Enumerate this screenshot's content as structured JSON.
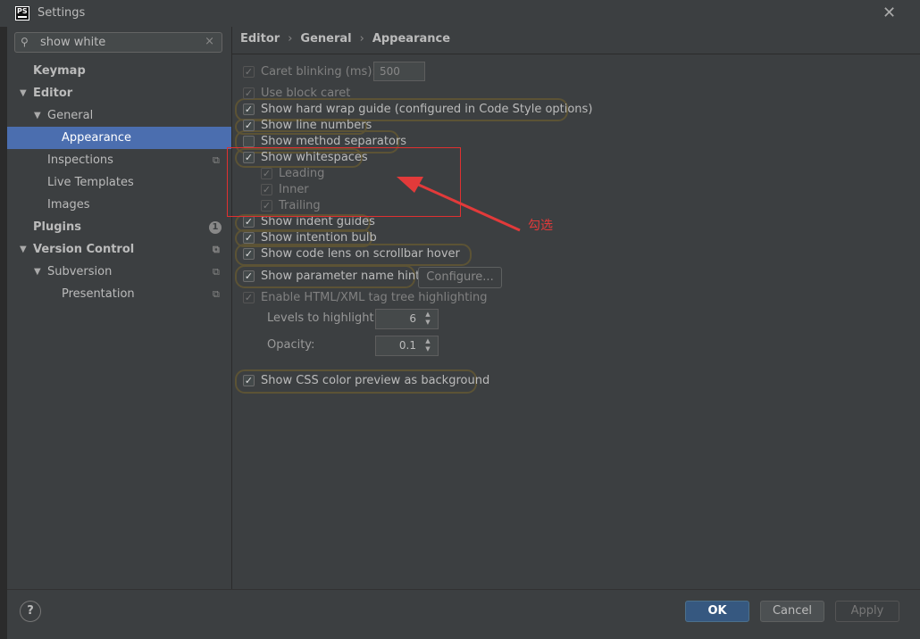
{
  "window": {
    "title": "Settings",
    "app_icon_text": "PS"
  },
  "search": {
    "value": "show white",
    "placeholder": ""
  },
  "tree": [
    {
      "label": "Keymap",
      "level": 0,
      "bold": true
    },
    {
      "label": "Editor",
      "level": 0,
      "bold": true,
      "expanded": true
    },
    {
      "label": "General",
      "level": 1,
      "expanded": true
    },
    {
      "label": "Appearance",
      "level": 2,
      "selected": true
    },
    {
      "label": "Inspections",
      "level": 1,
      "icon": "copy-icon"
    },
    {
      "label": "Live Templates",
      "level": 1
    },
    {
      "label": "Images",
      "level": 1
    },
    {
      "label": "Plugins",
      "level": 0,
      "bold": true,
      "badge": "1"
    },
    {
      "label": "Version Control",
      "level": 0,
      "bold": true,
      "expanded": true,
      "icon": "copy-icon"
    },
    {
      "label": "Subversion",
      "level": 1,
      "expanded": true,
      "icon": "copy-icon"
    },
    {
      "label": "Presentation",
      "level": 2,
      "icon": "copy-icon"
    }
  ],
  "breadcrumb": [
    "Editor",
    "General",
    "Appearance"
  ],
  "options": {
    "caret_blinking": {
      "label": "Caret blinking (ms):",
      "checked": true,
      "disabled": true,
      "value": "500"
    },
    "block_caret": {
      "label": "Use block caret",
      "checked": false,
      "disabled": true
    },
    "hard_wrap": {
      "label": "Show hard wrap guide (configured in Code Style options)",
      "checked": true
    },
    "line_numbers": {
      "label": "Show line numbers",
      "checked": true
    },
    "method_separators": {
      "label": "Show method separators",
      "checked": false
    },
    "whitespaces": {
      "label": "Show whitespaces",
      "checked": true
    },
    "leading": {
      "label": "Leading",
      "checked": true
    },
    "inner": {
      "label": "Inner",
      "checked": true
    },
    "trailing": {
      "label": "Trailing",
      "checked": true
    },
    "indent_guides": {
      "label": "Show indent guides",
      "checked": true
    },
    "intention_bulb": {
      "label": "Show intention bulb",
      "checked": true
    },
    "code_lens": {
      "label": "Show code lens on scrollbar hover",
      "checked": true
    },
    "param_hints": {
      "label": "Show parameter name hints",
      "checked": true,
      "button": "Configure..."
    },
    "html_xml": {
      "label": "Enable HTML/XML tag tree highlighting",
      "checked": true,
      "disabled": true
    },
    "levels": {
      "label": "Levels to highlight:",
      "value": "6"
    },
    "opacity": {
      "label": "Opacity:",
      "value": "0.1"
    },
    "css_color": {
      "label": "Show CSS color preview as background",
      "checked": true
    }
  },
  "annotation": {
    "note": "勾选",
    "color": "#e23a3a"
  },
  "buttons": {
    "ok": "OK",
    "cancel": "Cancel",
    "apply": "Apply",
    "help": "?"
  },
  "colors": {
    "selection": "#4b6eaf",
    "panel": "#3c3f41",
    "ok_button": "#365880"
  }
}
